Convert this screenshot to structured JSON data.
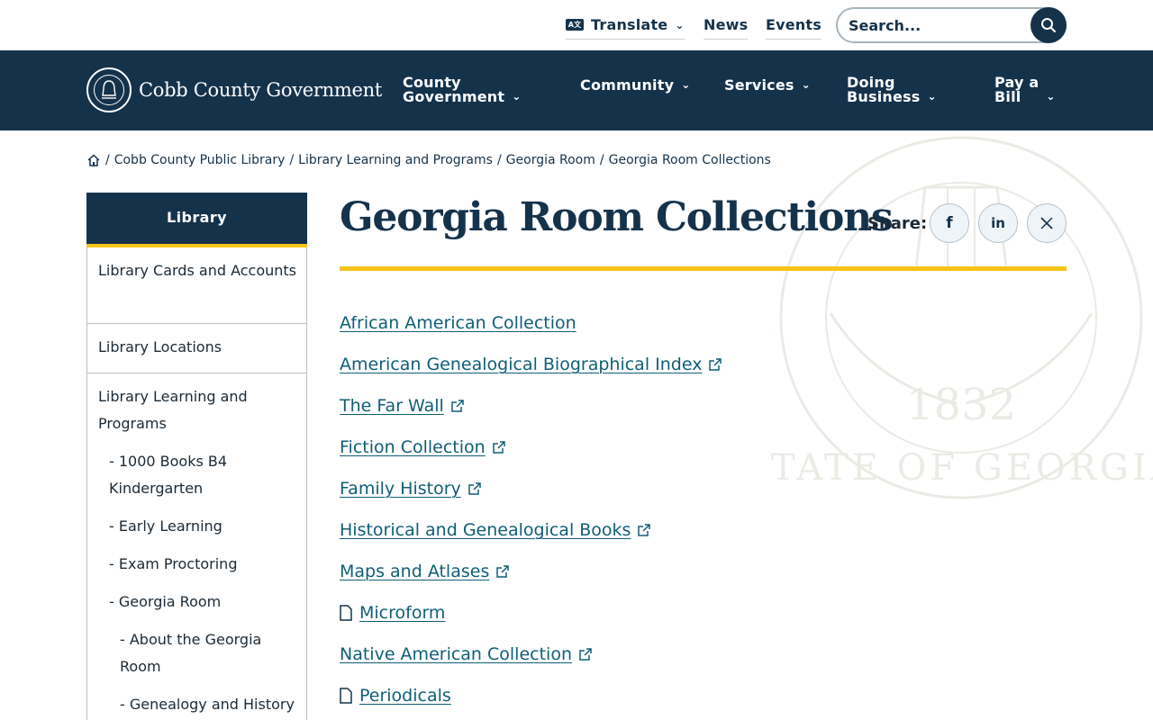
{
  "utility": {
    "translate_label": "Translate",
    "news_label": "News",
    "events_label": "Events",
    "search_placeholder": "Search..."
  },
  "header": {
    "logo_text": "Cobb County Government",
    "nav": [
      {
        "line1": "County",
        "line2": "Government"
      },
      {
        "line1": "Community"
      },
      {
        "line1": "Services"
      },
      {
        "line1": "Doing",
        "line2": "Business"
      },
      {
        "line1": "Pay a",
        "line2": "Bill"
      }
    ]
  },
  "breadcrumb": [
    "Cobb County Public Library",
    "Library Learning and Programs",
    "Georgia Room",
    "Georgia Room Collections"
  ],
  "sidebar": {
    "title": "Library",
    "items": [
      "Library Cards and Accounts",
      "Library Locations",
      "Library Learning and Programs",
      "- 1000 Books B4 Kindergarten",
      "- Early Learning",
      "- Exam Proctoring",
      "- Georgia Room",
      "- About the Georgia Room",
      "- Genealogy and History"
    ]
  },
  "main": {
    "title": "Georgia Room Collections",
    "share_label": "Share:",
    "collections": [
      {
        "label": "African American Collection",
        "icon": "none"
      },
      {
        "label": "American Genealogical Biographical Index",
        "icon": "external-link-icon"
      },
      {
        "label": "The Far Wall",
        "icon": "external-link-icon"
      },
      {
        "label": "Fiction Collection",
        "icon": "external-link-icon"
      },
      {
        "label": "Family History",
        "icon": "external-link-icon"
      },
      {
        "label": "Historical and Genealogical Books",
        "icon": "external-link-icon"
      },
      {
        "label": "Maps and Atlases",
        "icon": "external-link-icon"
      },
      {
        "label": "Microform",
        "icon": "document-icon"
      },
      {
        "label": "Native American Collection",
        "icon": "external-link-icon"
      },
      {
        "label": "Periodicals",
        "icon": "document-icon"
      }
    ]
  },
  "watermark": {
    "text": "STATE OF GEORGIA",
    "year": "1832"
  },
  "colors": {
    "navy": "#15324b",
    "gold": "#f5c518",
    "link": "#0f5e77"
  }
}
